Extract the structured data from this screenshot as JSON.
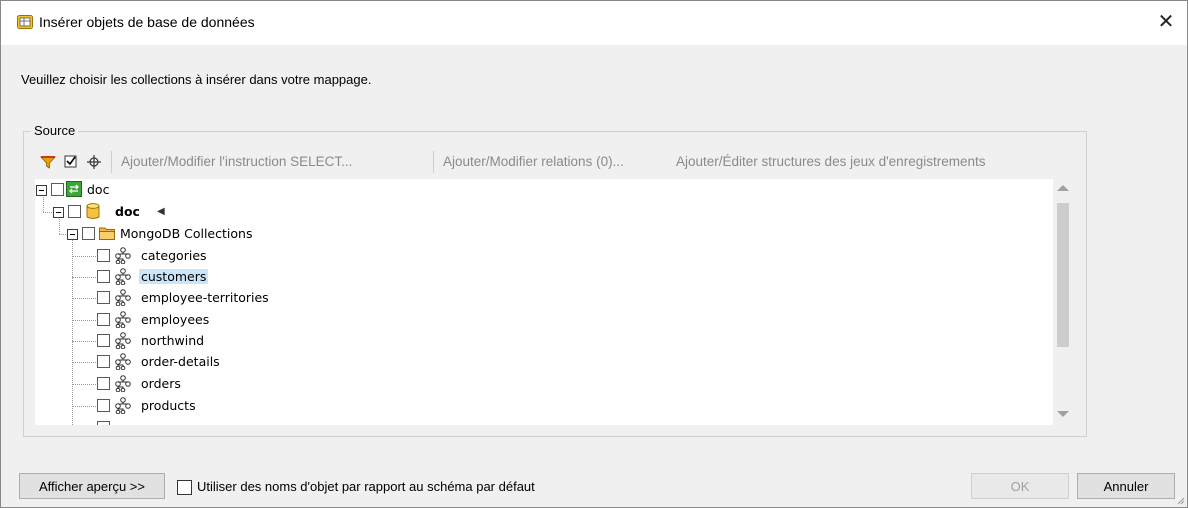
{
  "window": {
    "title": "Insérer objets de base de données",
    "close_icon": "close-icon"
  },
  "instruction": "Veuillez choisir les collections à insérer dans votre mappage.",
  "source_group": {
    "label": "Source",
    "toolbar": {
      "filter_icon": "filter-icon",
      "checked_icon": "checkbox-checked-icon",
      "locate_icon": "crosshair-icon",
      "select_statement": "Ajouter/Modifier l'instruction SELECT...",
      "relations": "Ajouter/Modifier relations (0)...",
      "recordset_structures": "Ajouter/Éditer structures des jeux d'enregistrements"
    },
    "tree": {
      "root": {
        "label": "doc",
        "icon": "database-connection-icon"
      },
      "database": {
        "label": "doc",
        "icon": "database-cylinder-icon"
      },
      "folder": {
        "label": "MongoDB Collections",
        "icon": "folder-icon"
      },
      "collections": [
        {
          "label": "categories",
          "selected": false
        },
        {
          "label": "customers",
          "selected": true
        },
        {
          "label": "employee-territories",
          "selected": false
        },
        {
          "label": "employees",
          "selected": false
        },
        {
          "label": "northwind",
          "selected": false
        },
        {
          "label": "order-details",
          "selected": false
        },
        {
          "label": "orders",
          "selected": false
        },
        {
          "label": "products",
          "selected": false
        }
      ]
    }
  },
  "footer": {
    "preview_button": "Afficher aperçu >>",
    "schema_option": "Utiliser des noms d'objet par rapport au schéma par défaut",
    "schema_option_checked": false,
    "ok_button": "OK",
    "ok_enabled": false,
    "cancel_button": "Annuler"
  },
  "colors": {
    "selection": "#cce4f7",
    "disabled_text": "#a0a0a0",
    "toolbar_text": "#8a8a8a"
  }
}
